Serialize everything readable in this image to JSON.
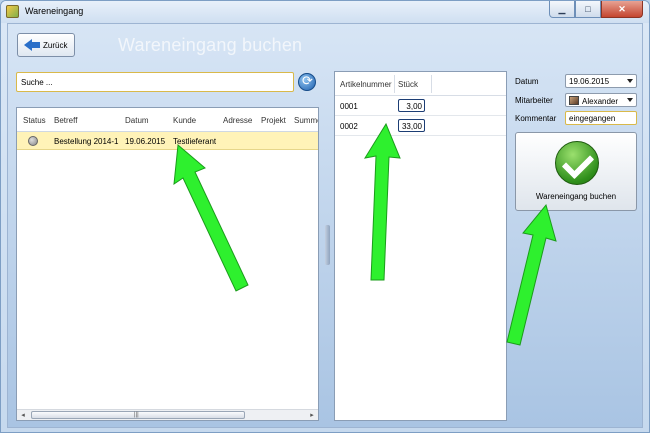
{
  "window": {
    "title": "Wareneingang"
  },
  "header": {
    "back_label": "Zurück",
    "page_title": "Wareneingang buchen"
  },
  "search": {
    "value": "Suche ..."
  },
  "orders_table": {
    "columns": [
      "Status",
      "Betreff",
      "Datum",
      "Kunde",
      "Adresse",
      "Projekt",
      "Summe"
    ],
    "rows": [
      {
        "betreff": "Bestellung 2014-1",
        "datum": "19.06.2015",
        "kunde": "Testlieferant"
      }
    ]
  },
  "items_table": {
    "columns": [
      "Artikelnummer",
      "Stück"
    ],
    "rows": [
      {
        "artikelnummer": "0001",
        "stueck": "3,00"
      },
      {
        "artikelnummer": "0002",
        "stueck": "33,00"
      }
    ]
  },
  "form": {
    "datum_label": "Datum",
    "datum_value": "19.06.2015",
    "mitarbeiter_label": "Mitarbeiter",
    "mitarbeiter_value": "Alexander",
    "kommentar_label": "Kommentar",
    "kommentar_value": "eingegangen"
  },
  "actions": {
    "book_label": "Wareneingang buchen"
  },
  "colors": {
    "annotation_arrow": "#2ef02e",
    "selected_row": "#fff3b8",
    "accent_blue": "#2a6fc9"
  }
}
